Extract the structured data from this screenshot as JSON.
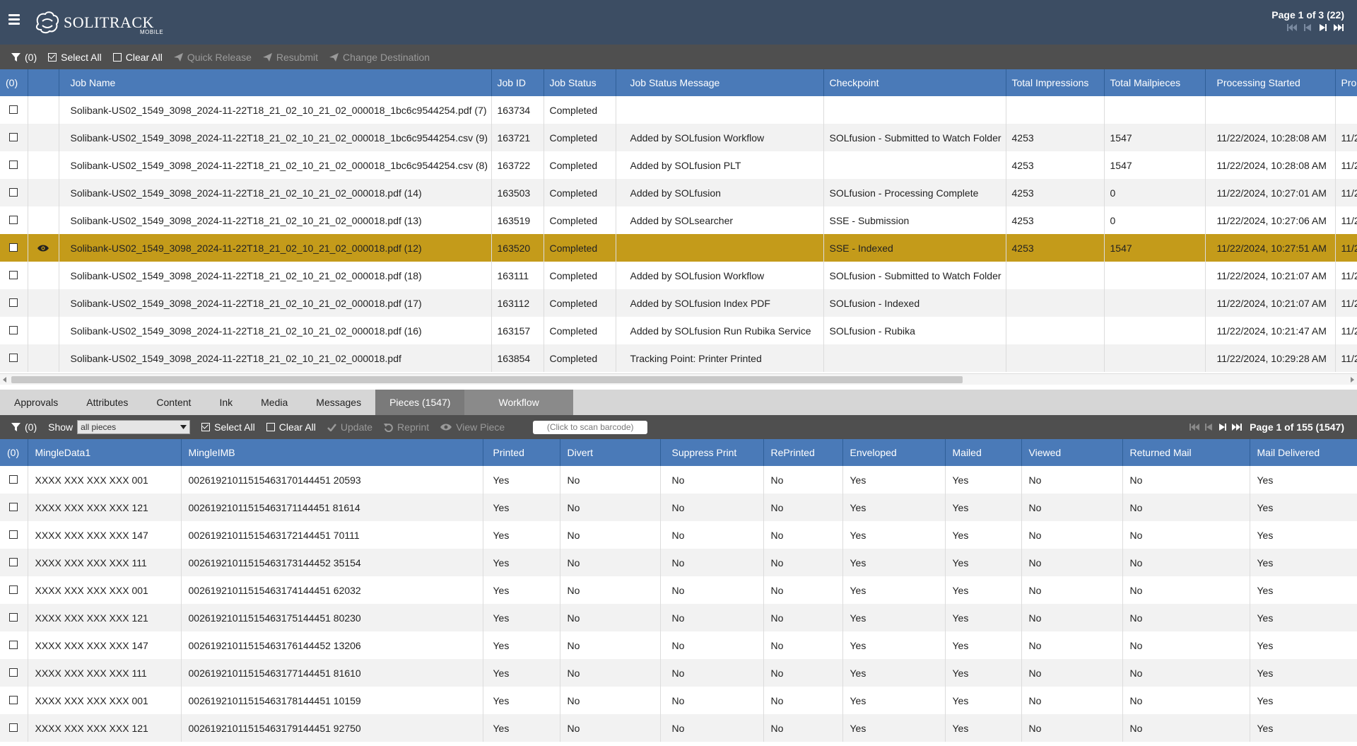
{
  "app": {
    "logo_text": "SOLITRACK",
    "logo_sub": "MOBILE"
  },
  "header_pager": {
    "label": "Page 1 of 3 (22)"
  },
  "job_toolbar": {
    "filter_count": "(0)",
    "select_all": "Select All",
    "clear_all": "Clear All",
    "quick_release": "Quick Release",
    "resubmit": "Resubmit",
    "change_destination": "Change Destination"
  },
  "jobs": {
    "columns": {
      "select": "(0)",
      "job_name": "Job Name",
      "job_id": "Job ID",
      "job_status": "Job Status",
      "job_status_message": "Job Status Message",
      "checkpoint": "Checkpoint",
      "total_impressions": "Total Impressions",
      "total_mailpieces": "Total Mailpieces",
      "processing_started": "Processing Started",
      "processing_more": "Pro"
    },
    "rows": [
      {
        "name": "Solibank-US02_1549_3098_2024-11-22T18_21_02_10_21_02_000018_1bc6c9544254.pdf (7)",
        "id": "163734",
        "status": "Completed",
        "message": "",
        "checkpoint": "",
        "impressions": "",
        "mailpieces": "",
        "started": "",
        "more": ""
      },
      {
        "name": "Solibank-US02_1549_3098_2024-11-22T18_21_02_10_21_02_000018_1bc6c9544254.csv (9)",
        "id": "163721",
        "status": "Completed",
        "message": "Added by SOLfusion Workflow",
        "checkpoint": "SOLfusion - Submitted to Watch Folder",
        "impressions": "4253",
        "mailpieces": "1547",
        "started": "11/22/2024, 10:28:08 AM",
        "more": "11/2"
      },
      {
        "name": "Solibank-US02_1549_3098_2024-11-22T18_21_02_10_21_02_000018_1bc6c9544254.csv (8)",
        "id": "163722",
        "status": "Completed",
        "message": "Added by SOLfusion PLT",
        "checkpoint": "",
        "impressions": "4253",
        "mailpieces": "1547",
        "started": "11/22/2024, 10:28:08 AM",
        "more": "11/2"
      },
      {
        "name": "Solibank-US02_1549_3098_2024-11-22T18_21_02_10_21_02_000018.pdf (14)",
        "id": "163503",
        "status": "Completed",
        "message": "Added by SOLfusion",
        "checkpoint": "SOLfusion - Processing Complete",
        "impressions": "4253",
        "mailpieces": "0",
        "started": "11/22/2024, 10:27:01 AM",
        "more": "11/2"
      },
      {
        "name": "Solibank-US02_1549_3098_2024-11-22T18_21_02_10_21_02_000018.pdf (13)",
        "id": "163519",
        "status": "Completed",
        "message": "Added by SOLsearcher",
        "checkpoint": "SSE - Submission",
        "impressions": "4253",
        "mailpieces": "0",
        "started": "11/22/2024, 10:27:06 AM",
        "more": "11/2"
      },
      {
        "name": "Solibank-US02_1549_3098_2024-11-22T18_21_02_10_21_02_000018.pdf (12)",
        "id": "163520",
        "status": "Completed",
        "message": "",
        "checkpoint": "SSE - Indexed",
        "impressions": "4253",
        "mailpieces": "1547",
        "started": "11/22/2024, 10:27:51 AM",
        "more": "11/2",
        "selected": true
      },
      {
        "name": "Solibank-US02_1549_3098_2024-11-22T18_21_02_10_21_02_000018.pdf (18)",
        "id": "163111",
        "status": "Completed",
        "message": "Added by SOLfusion Workflow",
        "checkpoint": "SOLfusion - Submitted to Watch Folder",
        "impressions": "",
        "mailpieces": "",
        "started": "11/22/2024, 10:21:07 AM",
        "more": "11/2"
      },
      {
        "name": "Solibank-US02_1549_3098_2024-11-22T18_21_02_10_21_02_000018.pdf (17)",
        "id": "163112",
        "status": "Completed",
        "message": "Added by SOLfusion Index PDF",
        "checkpoint": "SOLfusion - Indexed",
        "impressions": "",
        "mailpieces": "",
        "started": "11/22/2024, 10:21:07 AM",
        "more": "11/2"
      },
      {
        "name": "Solibank-US02_1549_3098_2024-11-22T18_21_02_10_21_02_000018.pdf (16)",
        "id": "163157",
        "status": "Completed",
        "message": "Added by SOLfusion Run Rubika Service",
        "checkpoint": "SOLfusion - Rubika",
        "impressions": "",
        "mailpieces": "",
        "started": "11/22/2024, 10:21:47 AM",
        "more": "11/2"
      },
      {
        "name": "Solibank-US02_1549_3098_2024-11-22T18_21_02_10_21_02_000018.pdf",
        "id": "163854",
        "status": "Completed",
        "message": "Tracking Point: Printer   Printed",
        "checkpoint": "",
        "impressions": "",
        "mailpieces": "",
        "started": "11/22/2024, 10:29:28 AM",
        "more": "11/2"
      }
    ]
  },
  "tabs": [
    {
      "label": "Approvals"
    },
    {
      "label": "Attributes"
    },
    {
      "label": "Content"
    },
    {
      "label": "Ink"
    },
    {
      "label": "Media"
    },
    {
      "label": "Messages"
    },
    {
      "label": "Pieces (1547)",
      "active": true
    },
    {
      "label": "Workflow",
      "dim": true
    }
  ],
  "pieces_toolbar": {
    "filter_count": "(0)",
    "show_label": "Show",
    "show_value": "all pieces",
    "select_all": "Select All",
    "clear_all": "Clear All",
    "update": "Update",
    "reprint": "Reprint",
    "view_piece": "View Piece",
    "barcode_placeholder": "(Click to scan barcode)",
    "pager_label": "Page 1 of 155 (1547)"
  },
  "pieces": {
    "columns": {
      "select": "(0)",
      "mingledata1": "MingleData1",
      "mingleimb": "MingleIMB",
      "printed": "Printed",
      "divert": "Divert",
      "suppress_print": "Suppress Print",
      "reprinted": "RePrinted",
      "enveloped": "Enveloped",
      "mailed": "Mailed",
      "viewed": "Viewed",
      "returned_mail": "Returned Mail",
      "mail_delivered": "Mail Delivered"
    },
    "rows": [
      {
        "data1": "XXXX XXX XXX XXX 001",
        "imb": "00261921011515463170144451 20593",
        "printed": "Yes",
        "divert": "No",
        "suppress": "No",
        "reprinted": "No",
        "enveloped": "Yes",
        "mailed": "Yes",
        "viewed": "No",
        "returned": "No",
        "delivered": "Yes"
      },
      {
        "data1": "XXXX XXX XXX XXX 121",
        "imb": "00261921011515463171144451 81614",
        "printed": "Yes",
        "divert": "No",
        "suppress": "No",
        "reprinted": "No",
        "enveloped": "Yes",
        "mailed": "Yes",
        "viewed": "No",
        "returned": "No",
        "delivered": "Yes"
      },
      {
        "data1": "XXXX XXX XXX XXX 147",
        "imb": "00261921011515463172144451 70111",
        "printed": "Yes",
        "divert": "No",
        "suppress": "No",
        "reprinted": "No",
        "enveloped": "Yes",
        "mailed": "Yes",
        "viewed": "No",
        "returned": "No",
        "delivered": "Yes"
      },
      {
        "data1": "XXXX XXX XXX XXX 111",
        "imb": "00261921011515463173144452 35154",
        "printed": "Yes",
        "divert": "No",
        "suppress": "No",
        "reprinted": "No",
        "enveloped": "Yes",
        "mailed": "Yes",
        "viewed": "No",
        "returned": "No",
        "delivered": "Yes"
      },
      {
        "data1": "XXXX XXX XXX XXX 001",
        "imb": "00261921011515463174144451 62032",
        "printed": "Yes",
        "divert": "No",
        "suppress": "No",
        "reprinted": "No",
        "enveloped": "Yes",
        "mailed": "Yes",
        "viewed": "No",
        "returned": "No",
        "delivered": "Yes"
      },
      {
        "data1": "XXXX XXX XXX XXX 121",
        "imb": "00261921011515463175144451 80230",
        "printed": "Yes",
        "divert": "No",
        "suppress": "No",
        "reprinted": "No",
        "enveloped": "Yes",
        "mailed": "Yes",
        "viewed": "No",
        "returned": "No",
        "delivered": "Yes"
      },
      {
        "data1": "XXXX XXX XXX XXX 147",
        "imb": "00261921011515463176144452 13206",
        "printed": "Yes",
        "divert": "No",
        "suppress": "No",
        "reprinted": "No",
        "enveloped": "Yes",
        "mailed": "Yes",
        "viewed": "No",
        "returned": "No",
        "delivered": "Yes"
      },
      {
        "data1": "XXXX XXX XXX XXX 111",
        "imb": "00261921011515463177144451 81610",
        "printed": "Yes",
        "divert": "No",
        "suppress": "No",
        "reprinted": "No",
        "enveloped": "Yes",
        "mailed": "Yes",
        "viewed": "No",
        "returned": "No",
        "delivered": "Yes"
      },
      {
        "data1": "XXXX XXX XXX XXX 001",
        "imb": "00261921011515463178144451 10159",
        "printed": "Yes",
        "divert": "No",
        "suppress": "No",
        "reprinted": "No",
        "enveloped": "Yes",
        "mailed": "Yes",
        "viewed": "No",
        "returned": "No",
        "delivered": "Yes"
      },
      {
        "data1": "XXXX XXX XXX XXX 121",
        "imb": "00261921011515463179144451 92750",
        "printed": "Yes",
        "divert": "No",
        "suppress": "No",
        "reprinted": "No",
        "enveloped": "Yes",
        "mailed": "Yes",
        "viewed": "No",
        "returned": "No",
        "delivered": "Yes"
      }
    ]
  }
}
